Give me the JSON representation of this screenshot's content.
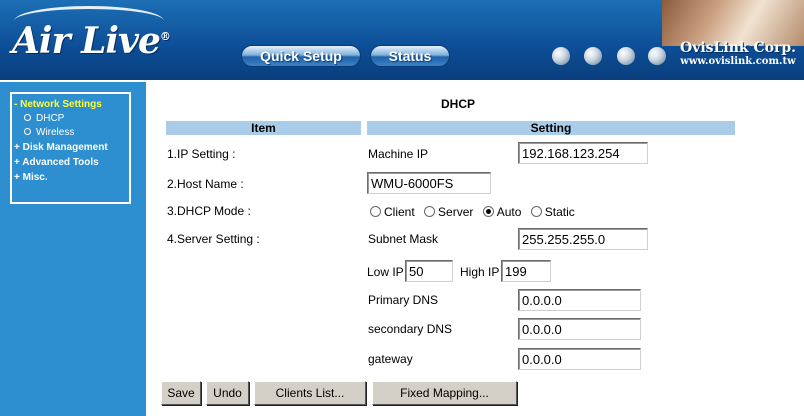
{
  "header": {
    "logo": "Air Live",
    "logo_mark": "®",
    "nav": [
      "Quick Setup",
      "Status"
    ],
    "company": "OvisLink Corp.",
    "company_url": "www.ovislink.com.tw"
  },
  "sidebar": {
    "items": [
      {
        "label": "- Network Settings",
        "active": true
      },
      {
        "label": "DHCP",
        "sub": true
      },
      {
        "label": "Wireless",
        "sub": true
      },
      {
        "label": "+ Disk Management"
      },
      {
        "label": "+ Advanced Tools"
      },
      {
        "label": "+ Misc."
      }
    ]
  },
  "main": {
    "title": "DHCP",
    "columns": [
      "Item",
      "Setting"
    ],
    "rows": {
      "ip_setting": "1.IP Setting :",
      "host_name": "2.Host Name :",
      "dhcp_mode": "3.DHCP Mode :",
      "server_setting": "4.Server Setting :"
    },
    "machine_ip_label": "Machine IP",
    "machine_ip": "192.168.123.254",
    "host_name": "WMU-6000FS",
    "dhcp_modes": [
      "Client",
      "Server",
      "Auto",
      "Static"
    ],
    "dhcp_mode_selected": "Auto",
    "subnet_mask_label": "Subnet Mask",
    "subnet_mask": "255.255.255.0",
    "low_ip_label": "Low IP",
    "low_ip": "50",
    "high_ip_label": "High IP",
    "high_ip": "199",
    "primary_dns_label": "Primary DNS",
    "primary_dns": "0.0.0.0",
    "secondary_dns_label": "secondary DNS",
    "secondary_dns": "0.0.0.0",
    "gateway_label": "gateway",
    "gateway": "0.0.0.0"
  },
  "buttons": {
    "save": "Save",
    "undo": "Undo",
    "clients_list": "Clients List...",
    "fixed_mapping": "Fixed Mapping..."
  }
}
